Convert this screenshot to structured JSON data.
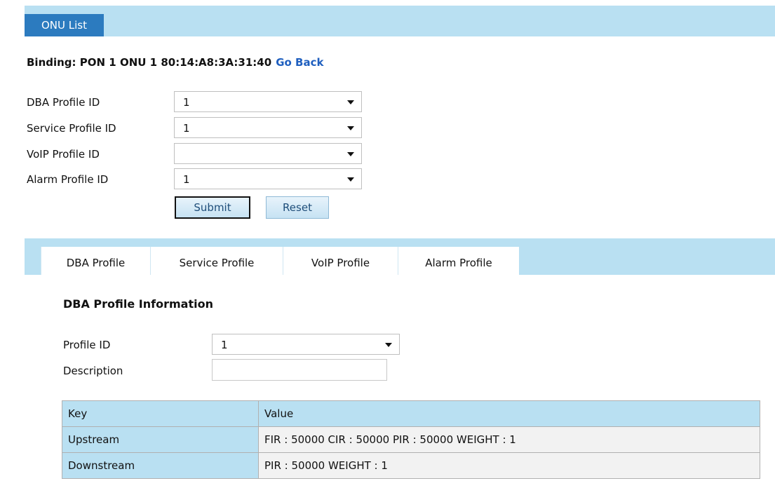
{
  "header": {
    "tab_label": "ONU List"
  },
  "binding": {
    "text": "Binding: PON 1 ONU 1 80:14:A8:3A:31:40",
    "go_back": "Go Back"
  },
  "profiles_form": {
    "fields": [
      {
        "label": "DBA Profile ID",
        "value": "1"
      },
      {
        "label": "Service Profile ID",
        "value": "1"
      },
      {
        "label": "VoIP Profile ID",
        "value": ""
      },
      {
        "label": "Alarm Profile ID",
        "value": "1"
      }
    ],
    "submit_label": "Submit",
    "reset_label": "Reset"
  },
  "tabs": [
    "DBA Profile",
    "Service Profile",
    "VoIP Profile",
    "Alarm Profile"
  ],
  "dba_info": {
    "title": "DBA Profile Information",
    "profile_id_label": "Profile ID",
    "profile_id_value": "1",
    "description_label": "Description",
    "description_value": "",
    "table": {
      "headers": [
        "Key",
        "Value"
      ],
      "rows": [
        {
          "key": "Upstream",
          "value": "FIR : 50000 CIR : 50000 PIR : 50000 WEIGHT : 1"
        },
        {
          "key": "Downstream",
          "value": "PIR : 50000 WEIGHT : 1"
        }
      ]
    }
  }
}
